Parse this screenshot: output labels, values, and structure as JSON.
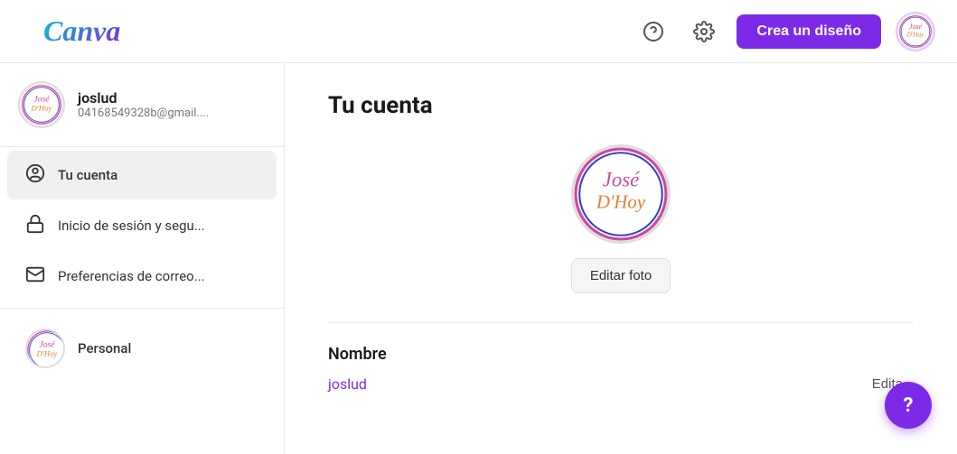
{
  "header": {
    "logo": "Canva",
    "help_label": "?",
    "settings_label": "settings",
    "create_button_label": "Crea un diseño"
  },
  "sidebar": {
    "user": {
      "name": "joslud",
      "email": "04168549328b@gmail...."
    },
    "items": [
      {
        "id": "tu-cuenta",
        "label": "Tu cuenta",
        "icon": "user-circle-icon",
        "active": true
      },
      {
        "id": "inicio-sesion",
        "label": "Inicio de sesión y segu...",
        "icon": "lock-icon",
        "active": false
      },
      {
        "id": "preferencias-correo",
        "label": "Preferencias de correo...",
        "icon": "email-icon",
        "active": false
      }
    ],
    "team": {
      "label": "Personal"
    }
  },
  "content": {
    "page_title": "Tu cuenta",
    "edit_photo_button": "Editar foto",
    "fields": [
      {
        "label": "Nombre",
        "value": "joslud",
        "edit_label": "Edita"
      }
    ]
  },
  "help_button_label": "?"
}
